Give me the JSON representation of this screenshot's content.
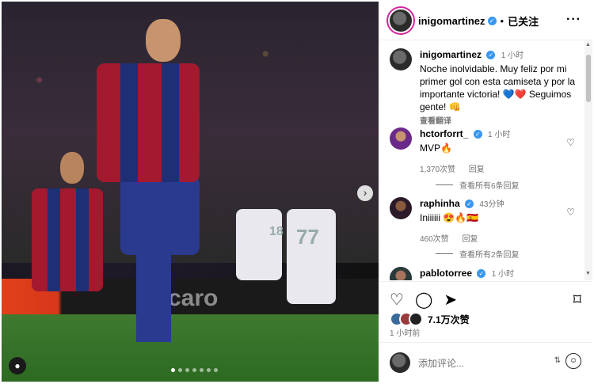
{
  "post": {
    "username": "inigomartinez",
    "follow_state": "已关注",
    "caption_time": "1 小时",
    "caption": "Noche inolvidable. Muy feliz por mi primer gol con esta camiseta y por la importante victoria! 💙❤️ Seguimos gente! 👊",
    "translate_label": "查看翻译",
    "photo_ad_text": "caro",
    "carousel_dots": 7,
    "carousel_active": 1
  },
  "comments": [
    {
      "username": "hctorforrt_",
      "time": "1 小时",
      "text": "MVP🔥",
      "likes": "1,370次赞",
      "reply": "回复",
      "view_replies": "查看所有6条回复"
    },
    {
      "username": "raphinha",
      "time": "43分钟",
      "text": "Iniiiiii 😍🔥🇪🇸",
      "likes": "460次赞",
      "reply": "回复",
      "view_replies": "查看所有2条回复"
    },
    {
      "username": "pablotorree",
      "time": "1 小时"
    }
  ],
  "actions": {
    "likes_text": "7.1万次赞",
    "posted_ago": "1 小时前"
  },
  "add_comment": {
    "placeholder": "添加评论..."
  },
  "colors": {
    "verified": "#3897f0",
    "secondary_text": "#737373",
    "barca_red": "#a3192e",
    "barca_blue": "#1f2f75"
  },
  "icons": [
    "heart-icon",
    "comment-icon",
    "share-icon",
    "bookmark-icon",
    "more-icon",
    "emoji-icon",
    "arrow-right-icon",
    "user-tag-icon"
  ]
}
